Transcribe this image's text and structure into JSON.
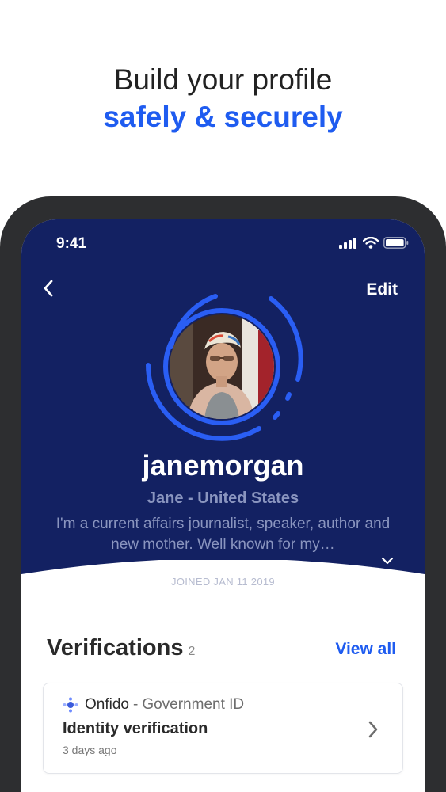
{
  "promo": {
    "line1": "Build your profile",
    "line2": "safely & securely"
  },
  "status_bar": {
    "time": "9:41"
  },
  "nav": {
    "back_icon": "chevron-left-icon",
    "edit_label": "Edit"
  },
  "profile": {
    "username": "janemorgan",
    "name_location": "Jane - United States",
    "bio": "I'm a current affairs journalist, speaker, author and new mother. Well known for my…",
    "joined": "JOINED JAN 11 2019",
    "expand_icon": "chevron-down-icon"
  },
  "verifications": {
    "title": "Verifications",
    "count": "2",
    "view_all_label": "View all",
    "items": [
      {
        "provider": "Onfido",
        "separator": "-",
        "type": "Government ID",
        "title": "Identity verification",
        "time": "3 days ago"
      }
    ]
  },
  "colors": {
    "brand_blue": "#1f5cf0",
    "hero_navy": "#132162",
    "phone_frame": "#2d2e30"
  }
}
